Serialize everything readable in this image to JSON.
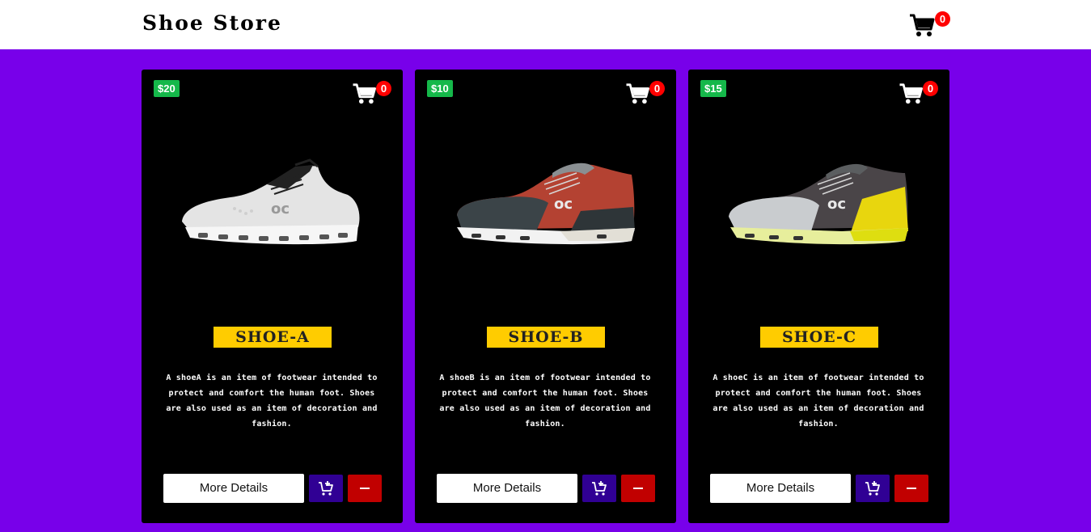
{
  "header": {
    "brand": "Shoe Store",
    "cart_count": "0"
  },
  "products": [
    {
      "price": "$20",
      "cart_count": "0",
      "name": "SHOE-A",
      "description": "A shoeA is an item of footwear intended to protect and comfort the human foot. Shoes are also used as an item of decoration and fashion.",
      "details_label": "More Details",
      "shoe_color": "white"
    },
    {
      "price": "$10",
      "cart_count": "0",
      "name": "SHOE-B",
      "description": "A shoeB is an item of footwear intended to protect and comfort the human foot. Shoes are also used as an item of decoration and fashion.",
      "details_label": "More Details",
      "shoe_color": "rust-red"
    },
    {
      "price": "$15",
      "cart_count": "0",
      "name": "SHOE-C",
      "description": "A shoeC is an item of footwear intended to protect and comfort the human foot. Shoes are also used as an item of decoration and fashion.",
      "details_label": "More Details",
      "shoe_color": "grey-yellow"
    }
  ],
  "icons": {
    "cart": "shopping-cart-icon",
    "add": "add-to-cart-icon",
    "remove": "minus-icon"
  },
  "colors": {
    "background": "#7800ea",
    "price_badge": "#15b84a",
    "name_tag": "#ffcc00",
    "add_button": "#300094",
    "remove_button": "#c10000",
    "badge": "#ff0000"
  }
}
